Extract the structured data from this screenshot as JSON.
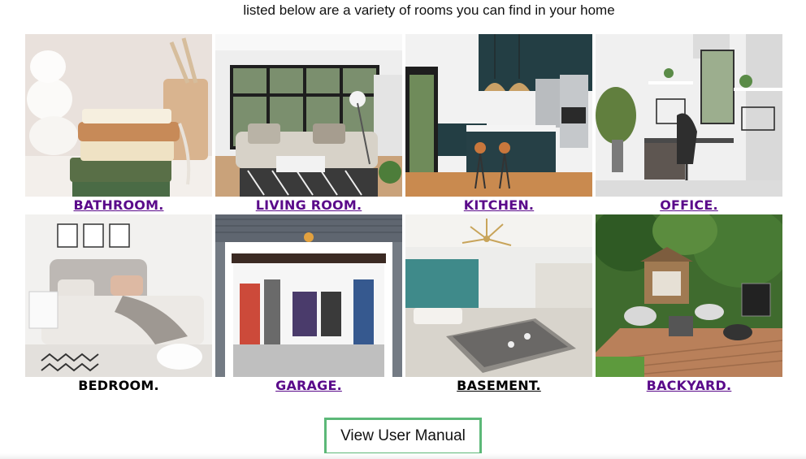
{
  "intro_text": "listed below are a variety of rooms you can find in your home",
  "rooms": [
    {
      "label": "BATHROOM.",
      "style": "link",
      "icon": "bathroom-photo"
    },
    {
      "label": "LIVING ROOM.",
      "style": "link",
      "icon": "living-room-photo"
    },
    {
      "label": "KITCHEN.",
      "style": "link",
      "icon": "kitchen-photo"
    },
    {
      "label": "OFFICE.",
      "style": "link",
      "icon": "office-photo"
    },
    {
      "label": "BEDROOM.",
      "style": "plain",
      "icon": "bedroom-photo"
    },
    {
      "label": "GARAGE.",
      "style": "link",
      "icon": "garage-photo"
    },
    {
      "label": "BASEMENT.",
      "style": "black-underline",
      "icon": "basement-photo"
    },
    {
      "label": "BACKYARD.",
      "style": "link",
      "icon": "backyard-photo"
    }
  ],
  "manual_button": {
    "label": "View User Manual",
    "border_color": "#5cb878"
  },
  "colors": {
    "link": "#5a0a8a",
    "text": "#111111"
  }
}
